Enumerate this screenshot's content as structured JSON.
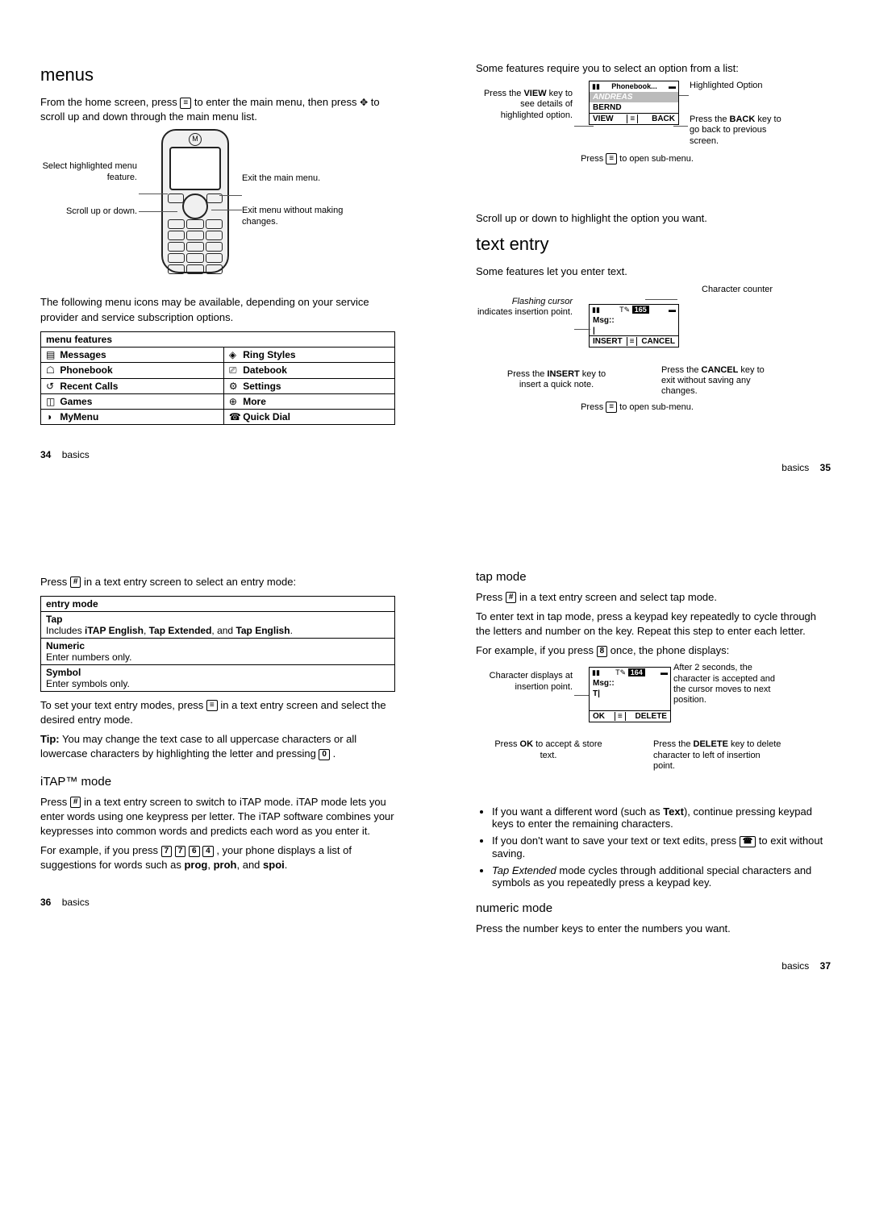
{
  "page34": {
    "heading": "menus",
    "intro_pre": "From the home screen, press ",
    "intro_mid": " to enter the main menu, then press ",
    "intro_post": " to scroll up and down through the main menu list.",
    "menu_key": "≡",
    "nav_key": "✥",
    "diag_select": "Select highlighted menu feature.",
    "diag_scroll": "Scroll up or down.",
    "diag_exitmain": "Exit the main menu.",
    "diag_exitnosave": "Exit menu without making changes.",
    "intro2": "The following menu icons may be available, depending on your service provider and service subscription options.",
    "table_header": "menu features",
    "rows": [
      {
        "l": "Messages",
        "r": "Ring Styles"
      },
      {
        "l": "Phonebook",
        "r": "Datebook"
      },
      {
        "l": "Recent Calls",
        "r": "Settings"
      },
      {
        "l": "Games",
        "r": "More"
      },
      {
        "l": "MyMenu",
        "r": "Quick Dial"
      }
    ],
    "footer_pn": "34",
    "footer_label": "basics"
  },
  "page35": {
    "intro": "Some features require you to select an option from a list:",
    "screen_title": "Phonebook...",
    "screen_item1": "ANDREAS",
    "screen_item2": "BERND",
    "screen_soft_left": "VIEW",
    "screen_soft_right": "BACK",
    "callout_hl": "Highlighted Option",
    "callout_view_pre": "Press the ",
    "callout_view_bold": "VIEW",
    "callout_view_post": " key to see details of highlighted option.",
    "callout_back_pre": "Press the ",
    "callout_back_bold": "BACK",
    "callout_back_post": " key to go back to previous screen.",
    "callout_menu_pre": "Press ",
    "callout_menu_post": " to open sub-menu.",
    "after": "Scroll up or down to highlight the option you want.",
    "heading": "text entry",
    "intro2": "Some features let you enter text.",
    "counter_label": "Character counter",
    "cursor_label_italic": "Flashing cursor",
    "cursor_label_post": " indicates insertion point.",
    "msg_label": "Msg::",
    "insert_label": "INSERT",
    "cancel_label": "CANCEL",
    "insert_callout_pre": "Press the ",
    "insert_callout_bold": "INSERT",
    "insert_callout_post": " key to insert a quick note.",
    "cancel_callout_pre": "Press the ",
    "cancel_callout_bold": "CANCEL",
    "cancel_callout_post": " key to exit without saving any changes.",
    "submenu_callout_pre": "Press ",
    "submenu_callout_post": " to open sub-menu.",
    "counter_val": "165",
    "footer_pn": "35",
    "footer_label": "basics"
  },
  "page36": {
    "intro_pre": "Press ",
    "hash_key": "#",
    "intro_post": " in a text entry screen to select an entry mode:",
    "table_header": "entry mode",
    "row1_h": "Tap",
    "row1_t_pre": "Includes ",
    "row1_b1": "iTAP English",
    "row1_t_mid1": ", ",
    "row1_b2": "Tap Extended",
    "row1_t_mid2": ", and ",
    "row1_b3": "Tap English",
    "row1_t_post": ".",
    "row2_h": "Numeric",
    "row2_t": "Enter numbers only.",
    "row3_h": "Symbol",
    "row3_t": "Enter symbols only.",
    "para_set_pre": "To set your text entry modes, press ",
    "menu_key": "≡",
    "para_set_post": " in a text entry screen and select the desired entry mode.",
    "tip_label": "Tip:",
    "tip_text_pre": " You may change the text case to all uppercase characters or all lowercase characters by highlighting the letter and pressing ",
    "zero_key": "0",
    "tip_text_post": ".",
    "itap_heading": "iTAP™ mode",
    "itap_p1_pre": "Press ",
    "itap_p1_post": " in a text entry screen to switch to iTAP mode. iTAP mode lets you enter words using one keypress per letter. The iTAP software combines your keypresses into common words and predicts each word as you enter it.",
    "itap_p2_pre": "For example, if you press ",
    "k7a": "7",
    "k7b": "7",
    "k6": "6",
    "k4": "4",
    "itap_p2_mid": " , your phone displays a list of suggestions for words such as ",
    "w1": "prog",
    "c1": ", ",
    "w2": "proh",
    "c2": ", and ",
    "w3": "spoi",
    "itap_p2_post": ".",
    "footer_pn": "36",
    "footer_label": "basics"
  },
  "page37": {
    "heading": "tap mode",
    "p1_pre": "Press ",
    "hash_key": "#",
    "p1_post": " in a text entry screen and select tap mode.",
    "p2": "To enter text in tap mode, press a keypad key repeatedly to cycle through the letters and number on the key. Repeat this step to enter each letter.",
    "p3_pre": "For example, if you press ",
    "eight_key": "8",
    "p3_post": " once, the phone displays:",
    "char_callout": "Character displays at insertion point.",
    "after2_callout": "After 2 seconds, the character is accepted and the cursor moves to next position.",
    "msg_label": "Msg::",
    "msg_text": "T|",
    "ok_label": "OK",
    "delete_label": "DELETE",
    "ok_callout_pre": "Press ",
    "ok_callout_bold": "OK",
    "ok_callout_post": " to accept & store text.",
    "delete_callout_pre": "Press the ",
    "delete_callout_bold": "DELETE",
    "delete_callout_post": " key to delete character to left of insertion point.",
    "counter_val": "164",
    "bullet1_pre": "If you want a different word (such as ",
    "bullet1_bold": "Text",
    "bullet1_post": "), continue pressing keypad keys to enter the remaining characters.",
    "bullet2_pre": "If you don't want to save your text or text edits, press ",
    "end_key": "☎",
    "bullet2_post": " to exit without saving.",
    "bullet3_italic": "Tap Extended",
    "bullet3_post": " mode cycles through additional special characters and symbols as you repeatedly press a keypad key.",
    "num_heading": "numeric mode",
    "num_p": "Press the number keys to enter the numbers you want.",
    "footer_pn": "37",
    "footer_label": "basics"
  }
}
